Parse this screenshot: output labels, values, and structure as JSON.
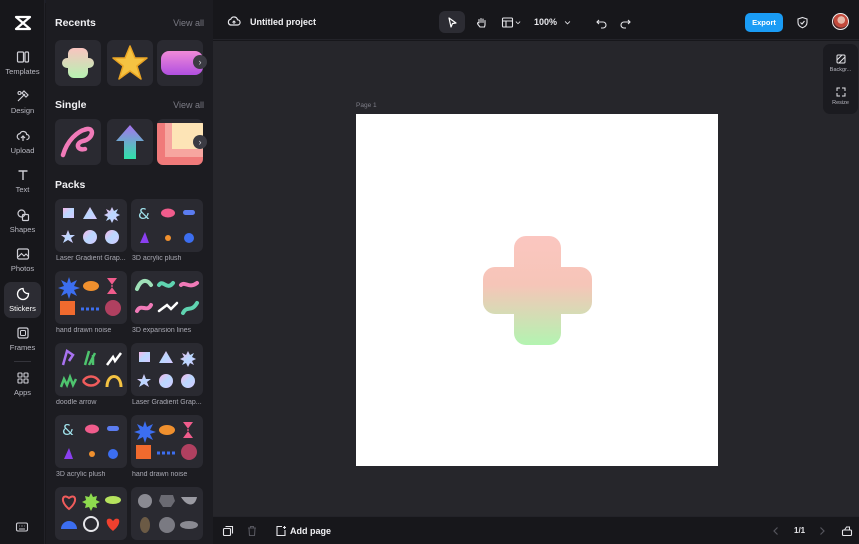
{
  "nav": {
    "items": [
      {
        "label": "Templates",
        "icon": "templates-icon"
      },
      {
        "label": "Design",
        "icon": "design-icon"
      },
      {
        "label": "Upload",
        "icon": "upload-icon"
      },
      {
        "label": "Text",
        "icon": "text-icon"
      },
      {
        "label": "Shapes",
        "icon": "shapes-icon"
      },
      {
        "label": "Photos",
        "icon": "photos-icon"
      },
      {
        "label": "Stickers",
        "icon": "stickers-icon",
        "active": true
      },
      {
        "label": "Frames",
        "icon": "frames-icon"
      },
      {
        "label": "Apps",
        "icon": "apps-icon"
      }
    ]
  },
  "panel": {
    "recents_title": "Recents",
    "recents_view_all": "View all",
    "single_title": "Single",
    "single_view_all": "View all",
    "packs_title": "Packs",
    "packs": [
      "Laser Gradient Grap...",
      "3D acrylic plush",
      "hand drawn noise",
      "3D expansion lines",
      "doodle arrow",
      "Laser Gradient Grap...",
      "3D acrylic plush",
      "hand drawn noise"
    ]
  },
  "header": {
    "project_title": "Untitled project",
    "zoom": "100%",
    "export_label": "Export"
  },
  "canvas": {
    "page_label": "Page 1"
  },
  "right_panel": {
    "background_label": "Backgr...",
    "resize_label": "Resize"
  },
  "footer": {
    "add_page_label": "Add page",
    "page_count": "1/1"
  },
  "colors": {
    "accent": "#1a9cf5",
    "sticker_top": "#f9c4c0",
    "sticker_bottom": "#b6f2b2"
  }
}
